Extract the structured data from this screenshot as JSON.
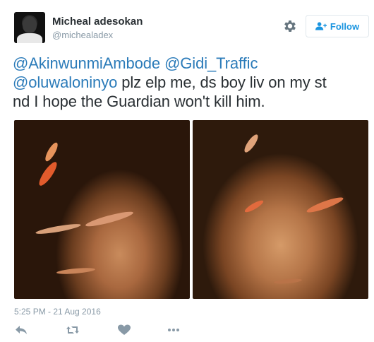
{
  "user": {
    "name": "Micheal adesokan",
    "handle": "@michealadex"
  },
  "follow_label": "Follow",
  "tweet": {
    "mention1": "@AkinwunmiAmbode",
    "mention2": "@Gidi_Traffic",
    "mention3": "@oluwaloninyo",
    "text1": " plz elp me, ds boy liv on my st",
    "text2": "nd I hope the Guardian won't kill him."
  },
  "timestamp": "5:25 PM - 21 Aug 2016",
  "icons": {
    "settings": "gear-icon",
    "follow": "add-user-icon",
    "reply": "reply-icon",
    "retweet": "retweet-icon",
    "like": "heart-icon",
    "more": "more-icon"
  },
  "colors": {
    "link": "#2b7bb9",
    "follow_text": "#1b95e0",
    "muted": "#8899a6"
  }
}
